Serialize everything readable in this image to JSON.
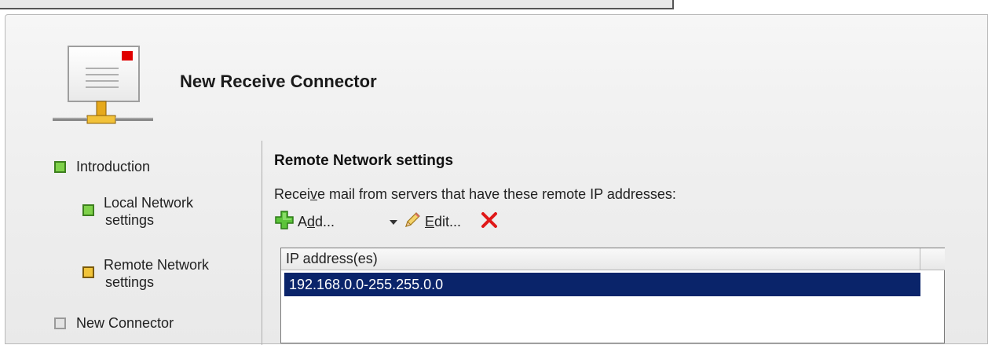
{
  "wizard": {
    "title": "New Receive Connector"
  },
  "nav": {
    "items": [
      {
        "label": "Introduction",
        "status": "complete",
        "color": "#7fd14a"
      },
      {
        "label_line1": "Local Network",
        "label_line2": "settings",
        "status": "complete",
        "color": "#7fd14a"
      },
      {
        "label_line1": "Remote Network",
        "label_line2": "settings",
        "status": "current",
        "color": "#f1c43a"
      },
      {
        "label": "New Connector",
        "status": "pending",
        "color": "#e3e3e3"
      }
    ]
  },
  "content": {
    "section_title": "Remote Network settings",
    "description_pre": "Recei",
    "description_accel": "v",
    "description_post": "e mail from servers that have these remote IP addresses:",
    "toolbar": {
      "add_pre": "A",
      "add_accel": "d",
      "add_post": "d...",
      "edit_accel": "E",
      "edit_post": "dit...",
      "icons": [
        "add-icon",
        "dropdown-arrow-icon",
        "edit-icon",
        "delete-icon"
      ]
    },
    "list": {
      "column_header": "IP address(es)",
      "rows": [
        "192.168.0.0-255.255.0.0"
      ],
      "selected_row_color": "#0a246a"
    }
  }
}
